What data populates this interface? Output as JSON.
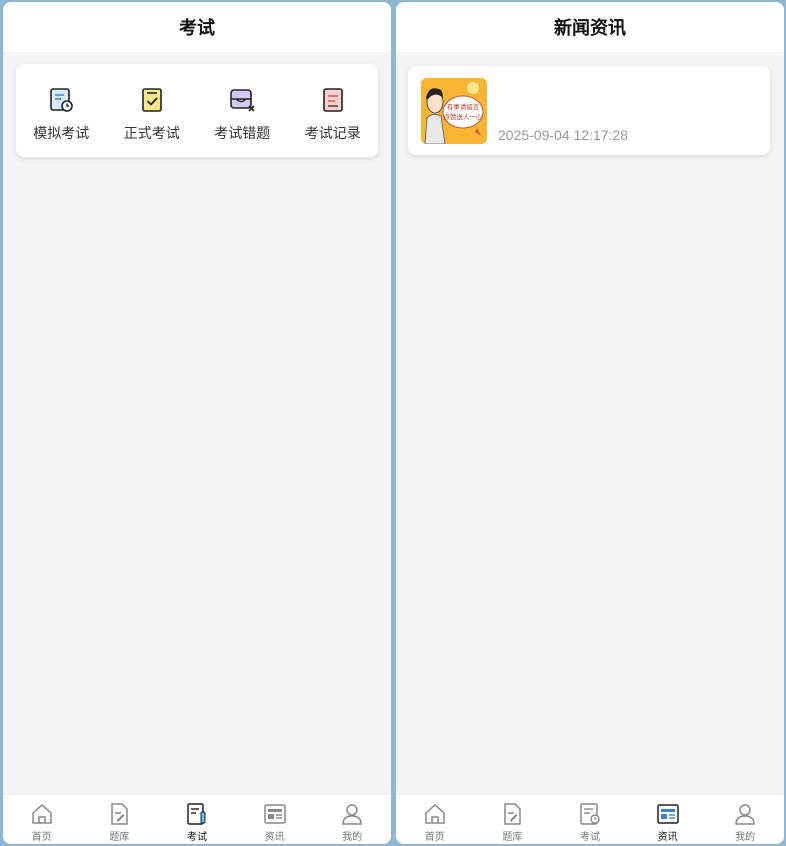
{
  "left": {
    "title": "考试",
    "exam_items": [
      {
        "label": "模拟考试",
        "icon": "mock-exam-icon"
      },
      {
        "label": "正式考试",
        "icon": "formal-exam-icon"
      },
      {
        "label": "考试错题",
        "icon": "wrong-questions-icon"
      },
      {
        "label": "考试记录",
        "icon": "exam-record-icon"
      }
    ],
    "tabs": [
      {
        "label": "首页",
        "icon": "home-icon"
      },
      {
        "label": "题库",
        "icon": "question-bank-icon"
      },
      {
        "label": "考试",
        "icon": "exam-icon",
        "active": true
      },
      {
        "label": "资讯",
        "icon": "news-icon"
      },
      {
        "label": "我的",
        "icon": "profile-icon"
      }
    ]
  },
  "right": {
    "title": "新闻资讯",
    "news": [
      {
        "time": "2025-09-04 12:17:28",
        "thumb_text": "有事请留言 点赞送人一心"
      }
    ],
    "tabs": [
      {
        "label": "首页",
        "icon": "home-icon"
      },
      {
        "label": "题库",
        "icon": "question-bank-icon"
      },
      {
        "label": "考试",
        "icon": "exam-icon"
      },
      {
        "label": "资讯",
        "icon": "news-icon",
        "active": true
      },
      {
        "label": "我的",
        "icon": "profile-icon"
      }
    ]
  },
  "colors": {
    "accent_blue": "#3b82d6",
    "thumb_orange": "#f7b531",
    "icon_gray": "#888888"
  }
}
